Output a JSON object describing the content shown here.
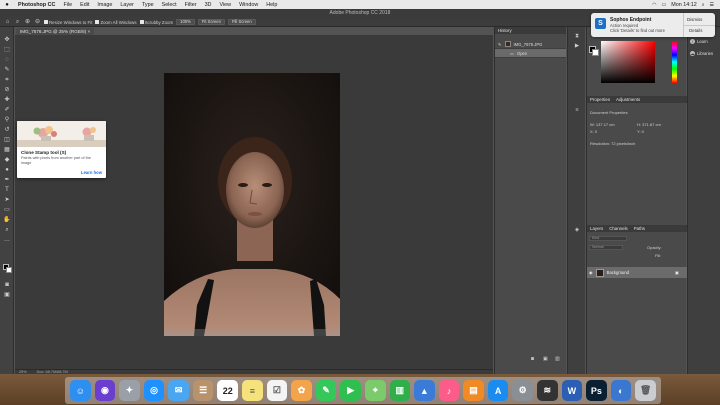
{
  "menubar": {
    "items": [
      "Photoshop CC",
      "File",
      "Edit",
      "Image",
      "Layer",
      "Type",
      "Select",
      "Filter",
      "3D",
      "View",
      "Window",
      "Help"
    ],
    "clock": "Mon 14:12"
  },
  "titlebar": {
    "title": "Adobe Photoshop CC 2018"
  },
  "options": {
    "resize_windows": "Resize Windows to Fit",
    "zoom_all": "Zoom All Windows",
    "scrubby_zoom": "Scrubby Zoom",
    "zoom_level": "100%",
    "fit_screen": "Fit Screen",
    "fill_screen": "Fill Screen"
  },
  "document": {
    "tab": "IMG_7676.JPG @ 25% (RGB/8)"
  },
  "status": {
    "zoom": "25%",
    "doc": "Doc: 68.7M/68.7M"
  },
  "tooltip": {
    "title": "Clone Stamp tool (S)",
    "desc": "Paints with pixels from another part of the image",
    "learn": "Learn how"
  },
  "history": {
    "header": "History",
    "snapshot": "IMG_7676.JPG",
    "open": "Open"
  },
  "properties": {
    "tab1": "Properties",
    "tab2": "Adjustments",
    "doc_label": "Document Properties",
    "w": "W: 137.17 cm",
    "h": "H: 371.87 cm",
    "x": "X: 0",
    "y": "Y: 0",
    "resolution": "Resolution: 72 pixels/inch"
  },
  "layers": {
    "tab1": "Layers",
    "tab2": "Channels",
    "tab3": "Paths",
    "kind": "Kind",
    "blend": "Normal",
    "opacity": "Opacity:",
    "fill": "Fill:",
    "background": "Background"
  },
  "libraries": {
    "learn": "Learn",
    "libraries": "Libraries"
  },
  "notification": {
    "title": "Sophos Endpoint",
    "line1": "Action required",
    "line2": "Click 'Details' to find out more",
    "dismiss": "Dismiss",
    "details": "Details"
  },
  "dock": {
    "calendar_day": "22",
    "apps": [
      {
        "name": "finder",
        "color": "#2d8ff0",
        "glyph": "☺"
      },
      {
        "name": "siri",
        "color": "#6a3fd0",
        "glyph": "◉"
      },
      {
        "name": "launchpad",
        "color": "#9aa0a8",
        "glyph": "✦"
      },
      {
        "name": "safari",
        "color": "#1e90ff",
        "glyph": "◎"
      },
      {
        "name": "mail",
        "color": "#4aa6f0",
        "glyph": "✉"
      },
      {
        "name": "contacts",
        "color": "#b8926a",
        "glyph": "☰"
      },
      {
        "name": "calendar",
        "color": "#ffffff",
        "glyph": ""
      },
      {
        "name": "notes",
        "color": "#f6e27a",
        "glyph": "≡"
      },
      {
        "name": "reminders",
        "color": "#f4f4f4",
        "glyph": "☑"
      },
      {
        "name": "photos",
        "color": "#f3a34a",
        "glyph": "✿"
      },
      {
        "name": "messages",
        "color": "#34c759",
        "glyph": "✎"
      },
      {
        "name": "facetime",
        "color": "#2fbf4f",
        "glyph": "▶"
      },
      {
        "name": "maps",
        "color": "#7ccb6a",
        "glyph": "⌖"
      },
      {
        "name": "numbers",
        "color": "#2fae4a",
        "glyph": "▥"
      },
      {
        "name": "keynote",
        "color": "#3b7bd8",
        "glyph": "▲"
      },
      {
        "name": "itunes",
        "color": "#fb5c8a",
        "glyph": "♪"
      },
      {
        "name": "ibooks",
        "color": "#f08a24",
        "glyph": "▤"
      },
      {
        "name": "appstore",
        "color": "#1a8cf0",
        "glyph": "A"
      },
      {
        "name": "system-prefs",
        "color": "#8a8f96",
        "glyph": "⚙"
      },
      {
        "name": "activity",
        "color": "#333333",
        "glyph": "≋"
      },
      {
        "name": "word",
        "color": "#2b5fb4",
        "glyph": "W"
      },
      {
        "name": "photoshop",
        "color": "#0b1f33",
        "glyph": "Ps"
      },
      {
        "name": "browser",
        "color": "#3a77d0",
        "glyph": "◐"
      },
      {
        "name": "trash",
        "color": "#c9ccd1",
        "glyph": "🗑"
      }
    ]
  }
}
